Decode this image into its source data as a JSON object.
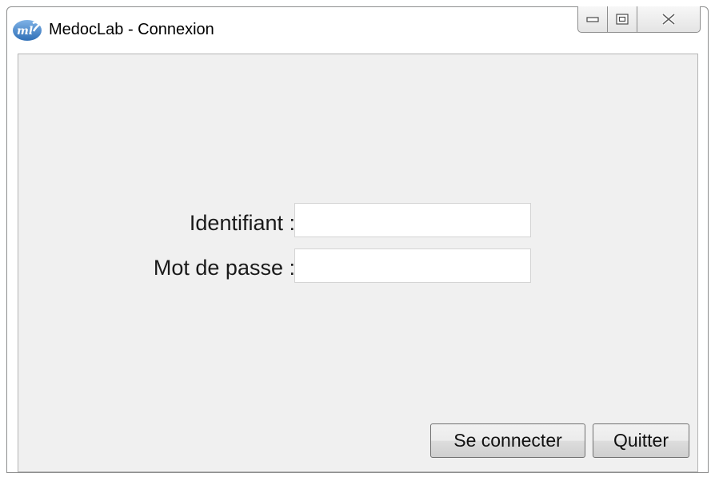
{
  "window": {
    "title": "MedocLab - Connexion",
    "app_icon": "medoclab-logo-icon",
    "caption_buttons": [
      "minimize-icon",
      "maximize-icon",
      "close-icon"
    ]
  },
  "form": {
    "identifiant_label": "Identifiant :",
    "identifiant_value": "",
    "password_label": "Mot de passe :",
    "password_value": ""
  },
  "actions": {
    "connect_label": "Se connecter",
    "quit_label": "Quitter"
  }
}
